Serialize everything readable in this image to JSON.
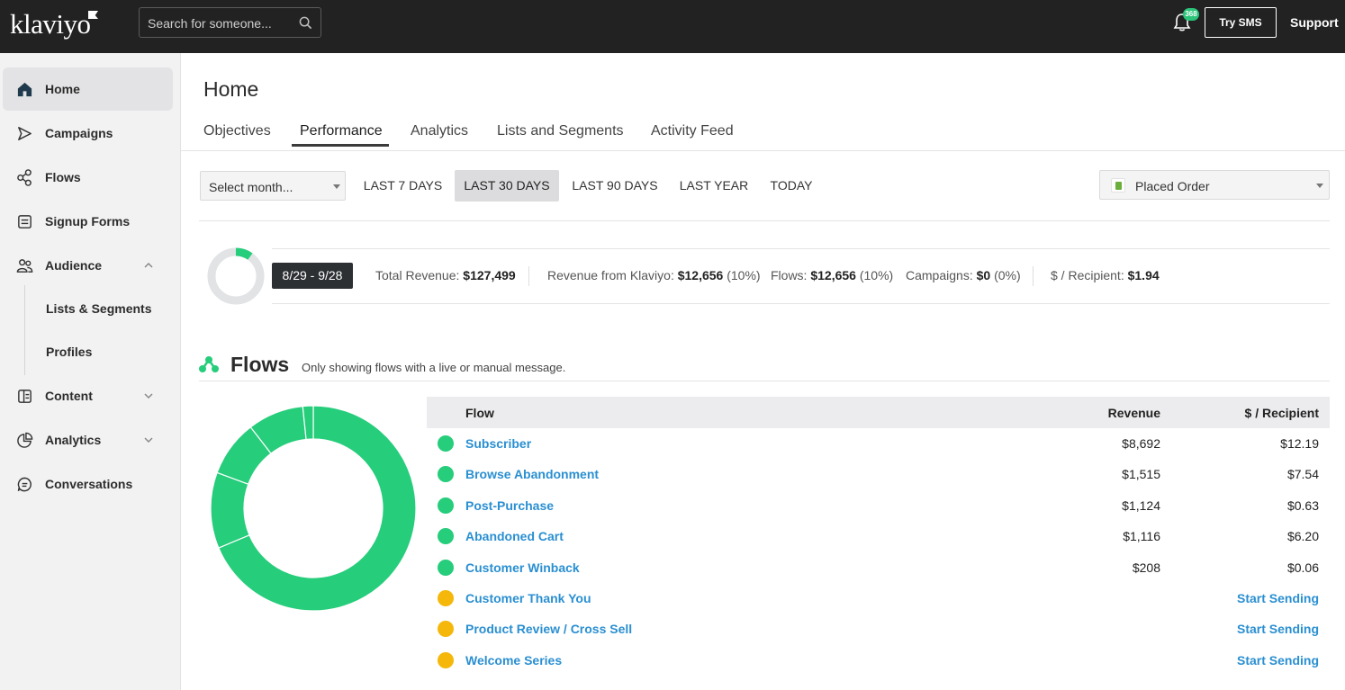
{
  "topbar": {
    "logo": "klaviyo",
    "search_placeholder": "Search for someone...",
    "notification_count": "368",
    "try_sms": "Try SMS",
    "support": "Support"
  },
  "sidebar": {
    "items": [
      {
        "label": "Home",
        "icon": "home-icon"
      },
      {
        "label": "Campaigns",
        "icon": "send-icon"
      },
      {
        "label": "Flows",
        "icon": "flows-icon"
      },
      {
        "label": "Signup Forms",
        "icon": "form-icon"
      },
      {
        "label": "Audience",
        "icon": "audience-icon"
      },
      {
        "label": "Content",
        "icon": "content-icon"
      },
      {
        "label": "Analytics",
        "icon": "analytics-icon"
      },
      {
        "label": "Conversations",
        "icon": "chat-icon"
      }
    ],
    "audience_sub": [
      "Lists & Segments",
      "Profiles"
    ]
  },
  "main": {
    "title": "Home",
    "tabs": [
      "Objectives",
      "Performance",
      "Analytics",
      "Lists and Segments",
      "Activity Feed"
    ],
    "active_tab": "Performance",
    "month_select": "Select month...",
    "ranges": [
      "LAST 7 DAYS",
      "LAST 30 DAYS",
      "LAST 90 DAYS",
      "LAST YEAR",
      "TODAY"
    ],
    "active_range": "LAST 30 DAYS",
    "metric_select": "Placed Order"
  },
  "summary": {
    "date_range": "8/29 - 9/28",
    "total_revenue_label": "Total Revenue:",
    "total_revenue": "$127,499",
    "klaviyo_label": "Revenue from Klaviyo:",
    "klaviyo_value": "$12,656",
    "klaviyo_pct": "(10%)",
    "flows_label": "Flows:",
    "flows_value": "$12,656",
    "flows_pct": "(10%)",
    "campaigns_label": "Campaigns:",
    "campaigns_value": "$0",
    "campaigns_pct": "(0%)",
    "recipient_label": "$ / Recipient:",
    "recipient_value": "$1.94",
    "klaviyo_share": 0.1
  },
  "flows": {
    "title": "Flows",
    "note": "Only showing flows with a live or manual message.",
    "columns": [
      "Flow",
      "Revenue",
      "$ / Recipient"
    ],
    "rows": [
      {
        "name": "Subscriber",
        "revenue": "$8,692",
        "per_recipient": "$12.19",
        "status": "live",
        "revenue_value": 8692
      },
      {
        "name": "Browse Abandonment",
        "revenue": "$1,515",
        "per_recipient": "$7.54",
        "status": "live",
        "revenue_value": 1515
      },
      {
        "name": "Post-Purchase",
        "revenue": "$1,124",
        "per_recipient": "$0.63",
        "status": "live",
        "revenue_value": 1124
      },
      {
        "name": "Abandoned Cart",
        "revenue": "$1,116",
        "per_recipient": "$6.20",
        "status": "live",
        "revenue_value": 1116
      },
      {
        "name": "Customer Winback",
        "revenue": "$208",
        "per_recipient": "$0.06",
        "status": "live",
        "revenue_value": 208
      },
      {
        "name": "Customer Thank You",
        "revenue": "",
        "per_recipient": "Start Sending",
        "status": "manual"
      },
      {
        "name": "Product Review / Cross Sell",
        "revenue": "",
        "per_recipient": "Start Sending",
        "status": "manual"
      },
      {
        "name": "Welcome Series",
        "revenue": "",
        "per_recipient": "Start Sending",
        "status": "manual"
      }
    ]
  },
  "colors": {
    "live": "#26cd7b",
    "manual": "#f5b70a",
    "link": "#2a8fd1",
    "topbar": "#222222"
  }
}
